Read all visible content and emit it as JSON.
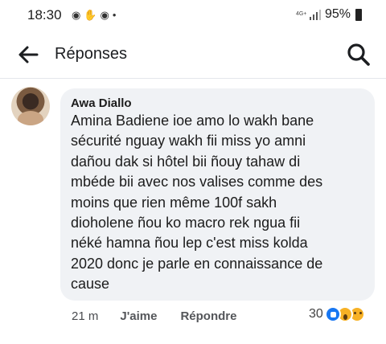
{
  "status_bar": {
    "time": "18:30",
    "left_icons": [
      "messenger-icon",
      "hand-icon",
      "messenger-icon",
      "dot-icon"
    ],
    "left_glyphs": [
      "◉",
      "✋",
      "◉",
      "•"
    ],
    "network_type": "4G+",
    "battery": "95%"
  },
  "header": {
    "title": "Réponses",
    "back_icon": "arrow-left-icon",
    "search_icon": "search-icon"
  },
  "comment": {
    "author": "Awa Diallo",
    "text": "Amina Badiene ioe amo lo wakh bane\nsécurité nguay wakh fii miss yo amni\ndañou dak si hôtel bii ñouy tahaw di\nmbéde bii avec nos valises comme des\nmoins que rien même 100f sakh\ndioholene ñou ko macro rek ngua fii\nnéké hamna ñou lep c'est miss kolda\n2020 donc je parle en connaissance de\ncause",
    "time": "21 m",
    "like_label": "J'aime",
    "reply_label": "Répondre",
    "reaction_count": "30",
    "reaction_icons": [
      "like-reaction-icon",
      "wow-reaction-icon",
      "sad-reaction-icon"
    ]
  },
  "colors": {
    "bubble": "#f0f2f5",
    "like_blue": "#1877f2",
    "emoji_yellow": "#f7b125"
  }
}
